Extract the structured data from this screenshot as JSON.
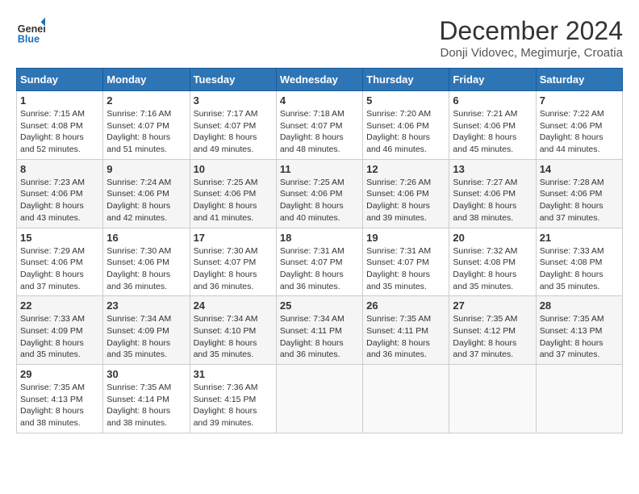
{
  "header": {
    "logo_line1": "General",
    "logo_line2": "Blue",
    "month": "December 2024",
    "location": "Donji Vidovec, Megimurje, Croatia"
  },
  "weekdays": [
    "Sunday",
    "Monday",
    "Tuesday",
    "Wednesday",
    "Thursday",
    "Friday",
    "Saturday"
  ],
  "weeks": [
    [
      {
        "day": "1",
        "sunrise": "Sunrise: 7:15 AM",
        "sunset": "Sunset: 4:08 PM",
        "daylight": "Daylight: 8 hours and 52 minutes."
      },
      {
        "day": "2",
        "sunrise": "Sunrise: 7:16 AM",
        "sunset": "Sunset: 4:07 PM",
        "daylight": "Daylight: 8 hours and 51 minutes."
      },
      {
        "day": "3",
        "sunrise": "Sunrise: 7:17 AM",
        "sunset": "Sunset: 4:07 PM",
        "daylight": "Daylight: 8 hours and 49 minutes."
      },
      {
        "day": "4",
        "sunrise": "Sunrise: 7:18 AM",
        "sunset": "Sunset: 4:07 PM",
        "daylight": "Daylight: 8 hours and 48 minutes."
      },
      {
        "day": "5",
        "sunrise": "Sunrise: 7:20 AM",
        "sunset": "Sunset: 4:06 PM",
        "daylight": "Daylight: 8 hours and 46 minutes."
      },
      {
        "day": "6",
        "sunrise": "Sunrise: 7:21 AM",
        "sunset": "Sunset: 4:06 PM",
        "daylight": "Daylight: 8 hours and 45 minutes."
      },
      {
        "day": "7",
        "sunrise": "Sunrise: 7:22 AM",
        "sunset": "Sunset: 4:06 PM",
        "daylight": "Daylight: 8 hours and 44 minutes."
      }
    ],
    [
      {
        "day": "8",
        "sunrise": "Sunrise: 7:23 AM",
        "sunset": "Sunset: 4:06 PM",
        "daylight": "Daylight: 8 hours and 43 minutes."
      },
      {
        "day": "9",
        "sunrise": "Sunrise: 7:24 AM",
        "sunset": "Sunset: 4:06 PM",
        "daylight": "Daylight: 8 hours and 42 minutes."
      },
      {
        "day": "10",
        "sunrise": "Sunrise: 7:25 AM",
        "sunset": "Sunset: 4:06 PM",
        "daylight": "Daylight: 8 hours and 41 minutes."
      },
      {
        "day": "11",
        "sunrise": "Sunrise: 7:25 AM",
        "sunset": "Sunset: 4:06 PM",
        "daylight": "Daylight: 8 hours and 40 minutes."
      },
      {
        "day": "12",
        "sunrise": "Sunrise: 7:26 AM",
        "sunset": "Sunset: 4:06 PM",
        "daylight": "Daylight: 8 hours and 39 minutes."
      },
      {
        "day": "13",
        "sunrise": "Sunrise: 7:27 AM",
        "sunset": "Sunset: 4:06 PM",
        "daylight": "Daylight: 8 hours and 38 minutes."
      },
      {
        "day": "14",
        "sunrise": "Sunrise: 7:28 AM",
        "sunset": "Sunset: 4:06 PM",
        "daylight": "Daylight: 8 hours and 37 minutes."
      }
    ],
    [
      {
        "day": "15",
        "sunrise": "Sunrise: 7:29 AM",
        "sunset": "Sunset: 4:06 PM",
        "daylight": "Daylight: 8 hours and 37 minutes."
      },
      {
        "day": "16",
        "sunrise": "Sunrise: 7:30 AM",
        "sunset": "Sunset: 4:06 PM",
        "daylight": "Daylight: 8 hours and 36 minutes."
      },
      {
        "day": "17",
        "sunrise": "Sunrise: 7:30 AM",
        "sunset": "Sunset: 4:07 PM",
        "daylight": "Daylight: 8 hours and 36 minutes."
      },
      {
        "day": "18",
        "sunrise": "Sunrise: 7:31 AM",
        "sunset": "Sunset: 4:07 PM",
        "daylight": "Daylight: 8 hours and 36 minutes."
      },
      {
        "day": "19",
        "sunrise": "Sunrise: 7:31 AM",
        "sunset": "Sunset: 4:07 PM",
        "daylight": "Daylight: 8 hours and 35 minutes."
      },
      {
        "day": "20",
        "sunrise": "Sunrise: 7:32 AM",
        "sunset": "Sunset: 4:08 PM",
        "daylight": "Daylight: 8 hours and 35 minutes."
      },
      {
        "day": "21",
        "sunrise": "Sunrise: 7:33 AM",
        "sunset": "Sunset: 4:08 PM",
        "daylight": "Daylight: 8 hours and 35 minutes."
      }
    ],
    [
      {
        "day": "22",
        "sunrise": "Sunrise: 7:33 AM",
        "sunset": "Sunset: 4:09 PM",
        "daylight": "Daylight: 8 hours and 35 minutes."
      },
      {
        "day": "23",
        "sunrise": "Sunrise: 7:34 AM",
        "sunset": "Sunset: 4:09 PM",
        "daylight": "Daylight: 8 hours and 35 minutes."
      },
      {
        "day": "24",
        "sunrise": "Sunrise: 7:34 AM",
        "sunset": "Sunset: 4:10 PM",
        "daylight": "Daylight: 8 hours and 35 minutes."
      },
      {
        "day": "25",
        "sunrise": "Sunrise: 7:34 AM",
        "sunset": "Sunset: 4:11 PM",
        "daylight": "Daylight: 8 hours and 36 minutes."
      },
      {
        "day": "26",
        "sunrise": "Sunrise: 7:35 AM",
        "sunset": "Sunset: 4:11 PM",
        "daylight": "Daylight: 8 hours and 36 minutes."
      },
      {
        "day": "27",
        "sunrise": "Sunrise: 7:35 AM",
        "sunset": "Sunset: 4:12 PM",
        "daylight": "Daylight: 8 hours and 37 minutes."
      },
      {
        "day": "28",
        "sunrise": "Sunrise: 7:35 AM",
        "sunset": "Sunset: 4:13 PM",
        "daylight": "Daylight: 8 hours and 37 minutes."
      }
    ],
    [
      {
        "day": "29",
        "sunrise": "Sunrise: 7:35 AM",
        "sunset": "Sunset: 4:13 PM",
        "daylight": "Daylight: 8 hours and 38 minutes."
      },
      {
        "day": "30",
        "sunrise": "Sunrise: 7:35 AM",
        "sunset": "Sunset: 4:14 PM",
        "daylight": "Daylight: 8 hours and 38 minutes."
      },
      {
        "day": "31",
        "sunrise": "Sunrise: 7:36 AM",
        "sunset": "Sunset: 4:15 PM",
        "daylight": "Daylight: 8 hours and 39 minutes."
      },
      null,
      null,
      null,
      null
    ]
  ]
}
